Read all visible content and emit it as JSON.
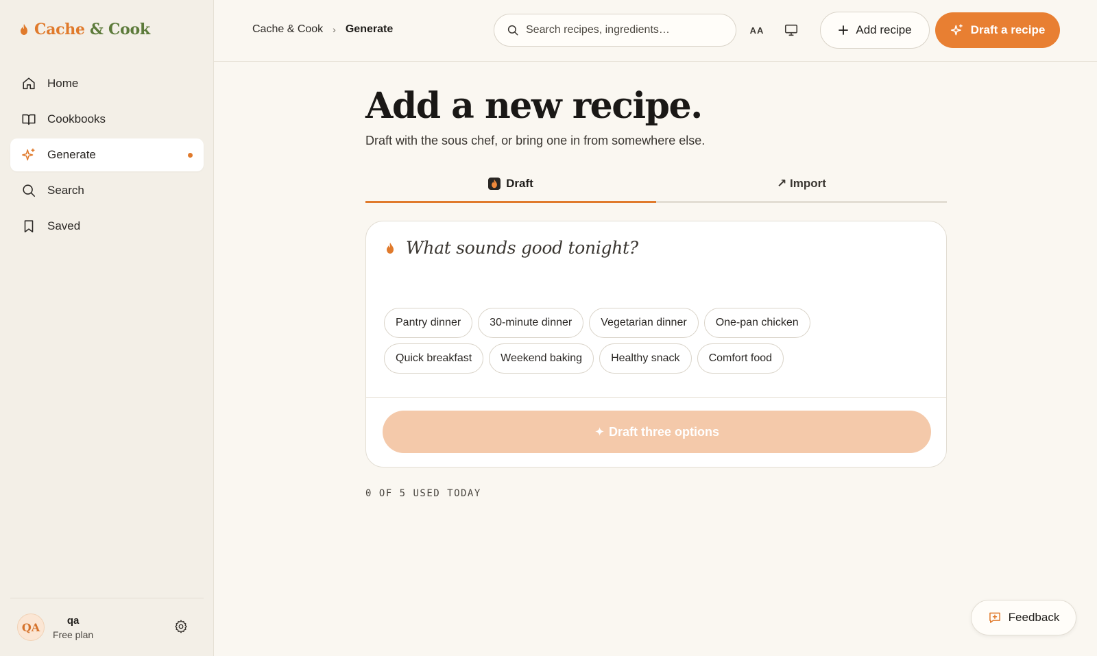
{
  "brand": {
    "part1": "Cache",
    "amp": " & ",
    "part2": "Cook"
  },
  "sidebar": {
    "items": [
      {
        "label": "Home",
        "icon": "home-icon"
      },
      {
        "label": "Cookbooks",
        "icon": "book-icon"
      },
      {
        "label": "Generate",
        "icon": "sparkle-icon",
        "active": true
      },
      {
        "label": "Search",
        "icon": "search-icon"
      },
      {
        "label": "Saved",
        "icon": "bookmark-icon"
      }
    ],
    "user": {
      "initials": "QA",
      "name": "qa",
      "plan": "Free plan"
    }
  },
  "header": {
    "breadcrumb": [
      "Cache & Cook",
      "Generate"
    ],
    "search_placeholder": "Search recipes, ingredients…",
    "text_size_label": "AA",
    "add_recipe": "Add recipe",
    "draft_recipe": "Draft a recipe"
  },
  "main": {
    "title": "Add a new recipe.",
    "subtitle": "Draft with the sous chef, or bring one in from somewhere else.",
    "tabs": [
      {
        "label": "Draft",
        "active": true
      },
      {
        "label": "↗ Import",
        "active": false
      }
    ],
    "prompt": "What sounds good tonight?",
    "chips_row1": [
      "Pantry dinner",
      "30-minute dinner",
      "Vegetarian dinner",
      "One-pan chicken"
    ],
    "chips_row2": [
      "Quick breakfast",
      "Weekend baking",
      "Healthy snack",
      "Comfort food"
    ],
    "draft_button": "Draft three options",
    "usage": "0 OF 5 USED TODAY"
  },
  "feedback": "Feedback",
  "colors": {
    "accent": "#e87f32",
    "brand_green": "#5c7a3a",
    "disabled_accent": "#f4c9aa"
  }
}
